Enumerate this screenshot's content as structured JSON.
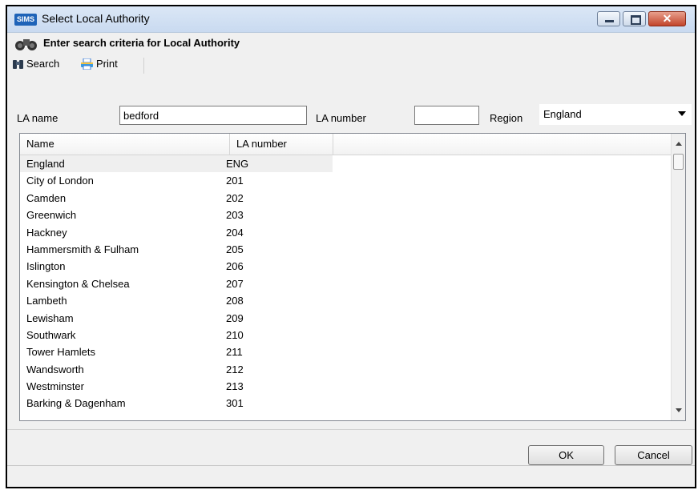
{
  "window": {
    "app_badge": "SIMS",
    "title": "Select Local Authority",
    "close_glyph": "✕"
  },
  "header": {
    "icon": "binoculars-icon",
    "text": "Enter search criteria for Local Authority"
  },
  "toolbar": {
    "search_label": "Search",
    "print_label": "Print"
  },
  "criteria": {
    "la_name_label": "LA name",
    "la_name_value": "bedford",
    "la_number_label": "LA number",
    "la_number_value": "",
    "region_label": "Region",
    "region_value": "England"
  },
  "grid": {
    "columns": [
      "Name",
      "LA number"
    ],
    "rows": [
      {
        "name": "England",
        "number": "ENG"
      },
      {
        "name": "City of London",
        "number": "201"
      },
      {
        "name": "Camden",
        "number": "202"
      },
      {
        "name": "Greenwich",
        "number": "203"
      },
      {
        "name": "Hackney",
        "number": "204"
      },
      {
        "name": "Hammersmith & Fulham",
        "number": "205"
      },
      {
        "name": "Islington",
        "number": "206"
      },
      {
        "name": "Kensington & Chelsea",
        "number": "207"
      },
      {
        "name": "Lambeth",
        "number": "208"
      },
      {
        "name": "Lewisham",
        "number": "209"
      },
      {
        "name": "Southwark",
        "number": "210"
      },
      {
        "name": "Tower Hamlets",
        "number": "211"
      },
      {
        "name": "Wandsworth",
        "number": "212"
      },
      {
        "name": "Westminster",
        "number": "213"
      },
      {
        "name": "Barking & Dagenham",
        "number": "301"
      }
    ]
  },
  "buttons": {
    "ok_label": "OK",
    "cancel_label": "Cancel"
  },
  "colors": {
    "title_bar": "#c9daf0",
    "close_button": "#c2452b",
    "selected_row": "#efefef"
  }
}
